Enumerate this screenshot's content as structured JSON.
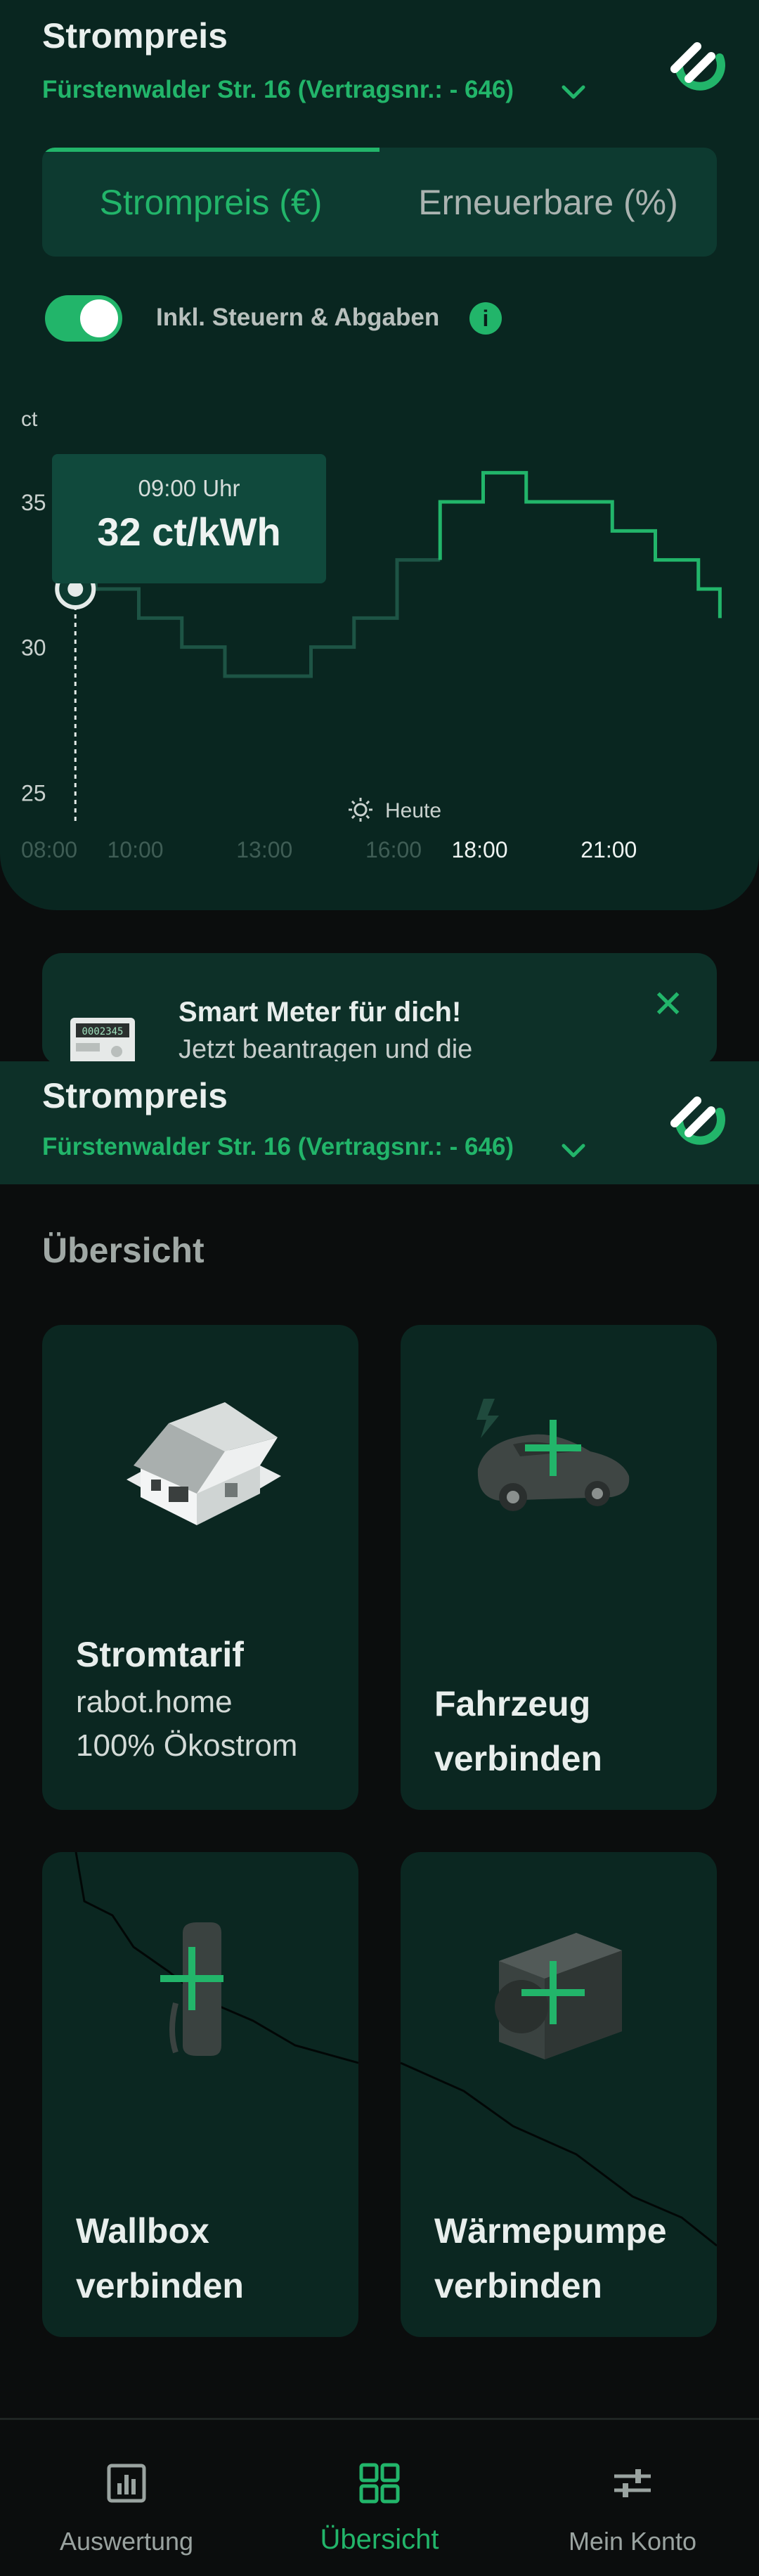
{
  "header": {
    "title": "Strompreis",
    "contract": "Fürstenwalder Str. 16 (Vertragsnr.: - 646)",
    "accent": "#22b56a"
  },
  "tabs": [
    {
      "label": "Strompreis (€)",
      "active": true
    },
    {
      "label": "Erneuerbare (%)",
      "active": false
    }
  ],
  "tax_toggle": {
    "label": "Inkl. Steuern & Abgaben",
    "on": true
  },
  "tooltip": {
    "time": "09:00 Uhr",
    "value": "32 ct/kWh"
  },
  "today_label": "Heute",
  "chart_data": {
    "type": "line",
    "ylabel": "ct",
    "yticks": [
      "35",
      "30",
      "25"
    ],
    "ylim": [
      23,
      38
    ],
    "xticks": [
      "08:00",
      "10:00",
      "13:00",
      "16:00",
      "18:00",
      "21:00"
    ],
    "xtick_values": [
      8,
      10,
      13,
      16,
      18,
      21
    ],
    "xlim": [
      8,
      24
    ],
    "past_until": 17,
    "series": [
      {
        "x": [
          8,
          9,
          10,
          11,
          12,
          13,
          14,
          15,
          16,
          17,
          18,
          19,
          20,
          21,
          22,
          23,
          23.5
        ],
        "y": [
          33,
          32,
          31,
          30,
          29,
          29,
          30,
          31,
          33,
          35,
          36,
          35,
          35,
          34,
          33,
          32,
          31
        ]
      }
    ],
    "highlight": {
      "x": 9,
      "y": 32
    }
  },
  "banner": {
    "title": "Smart Meter für dich!",
    "text": "Jetzt beantragen und die",
    "meter_display": "0002345"
  },
  "overview": {
    "title": "Übersicht",
    "cards": [
      {
        "title": "Stromtarif",
        "lines": [
          "rabot.home",
          "100% Ökostrom"
        ],
        "icon": "house-icon"
      },
      {
        "title_lines": [
          "Fahrzeug",
          "verbinden"
        ],
        "icon": "car-plus-icon"
      },
      {
        "title_lines": [
          "Wallbox",
          "verbinden"
        ],
        "icon": "wallbox-plus-icon"
      },
      {
        "title_lines": [
          "Wärmepumpe",
          "verbinden"
        ],
        "icon": "heatpump-plus-icon"
      }
    ]
  },
  "nav": {
    "items": [
      {
        "label": "Auswertung",
        "icon": "chart-icon",
        "active": false
      },
      {
        "label": "Übersicht",
        "icon": "grid-icon",
        "active": true
      },
      {
        "label": "Mein Konto",
        "icon": "sliders-icon",
        "active": false
      }
    ]
  }
}
